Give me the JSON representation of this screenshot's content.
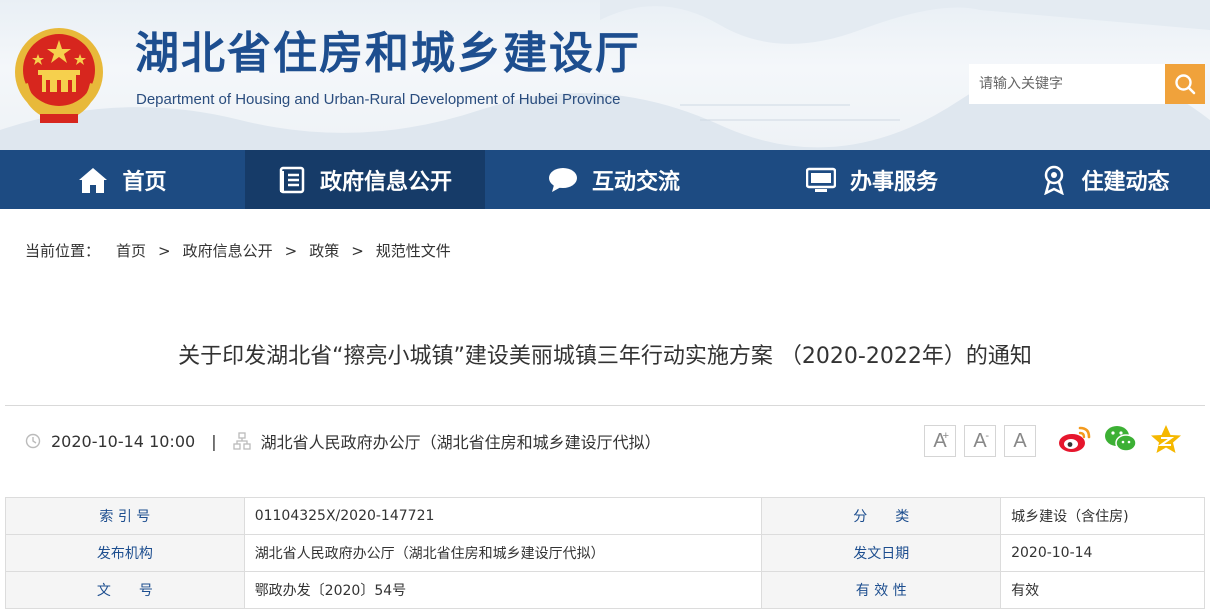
{
  "header": {
    "site_title": "湖北省住房和城乡建设厅",
    "site_subtitle": "Department of Housing and Urban-Rural Development of Hubei Province",
    "search_placeholder": "请输入关键字"
  },
  "nav": {
    "items": [
      {
        "label": "首页",
        "icon": "home-icon"
      },
      {
        "label": "政府信息公开",
        "icon": "document-list-icon",
        "active": true
      },
      {
        "label": "互动交流",
        "icon": "chat-bubble-icon"
      },
      {
        "label": "办事服务",
        "icon": "monitor-icon"
      },
      {
        "label": "住建动态",
        "icon": "location-pin-icon"
      }
    ]
  },
  "breadcrumb": {
    "label": "当前位置：",
    "items": [
      "首页",
      "政府信息公开",
      "政策",
      "规范性文件"
    ],
    "separator": ">"
  },
  "article": {
    "title": "关于印发湖北省“擦亮小城镇”建设美丽城镇三年行动实施方案 （2020-2022年）的通知",
    "date": "2020-10-14 10:00",
    "meta_separator": "|",
    "source": "湖北省人民政府办公厅（湖北省住房和城乡建设厅代拟）"
  },
  "font_size_buttons": {
    "large": "A",
    "medium": "A",
    "small": "A",
    "plus": "+",
    "minus": "-"
  },
  "share_icons": [
    "weibo-icon",
    "wechat-icon",
    "qzone-icon"
  ],
  "info_table": {
    "rows": [
      {
        "k1": "索 引 号",
        "v1": "01104325X/2020-147721",
        "k2": "分　　类",
        "v2": "城乡建设（含住房)"
      },
      {
        "k1": "发布机构",
        "v1": "湖北省人民政府办公厅（湖北省住房和城乡建设厅代拟）",
        "k2": "发文日期",
        "v2": "2020-10-14"
      },
      {
        "k1": "文　　号",
        "v1": "鄂政办发〔2020〕54号",
        "k2": "有 效 性",
        "v2": "有效"
      }
    ]
  },
  "colors": {
    "brand_blue": "#1d4b82",
    "nav_active": "#163b68",
    "search_button": "#f0a23b",
    "weibo": "#e6162d",
    "wechat": "#3cb034",
    "qzone": "#f5b800"
  }
}
